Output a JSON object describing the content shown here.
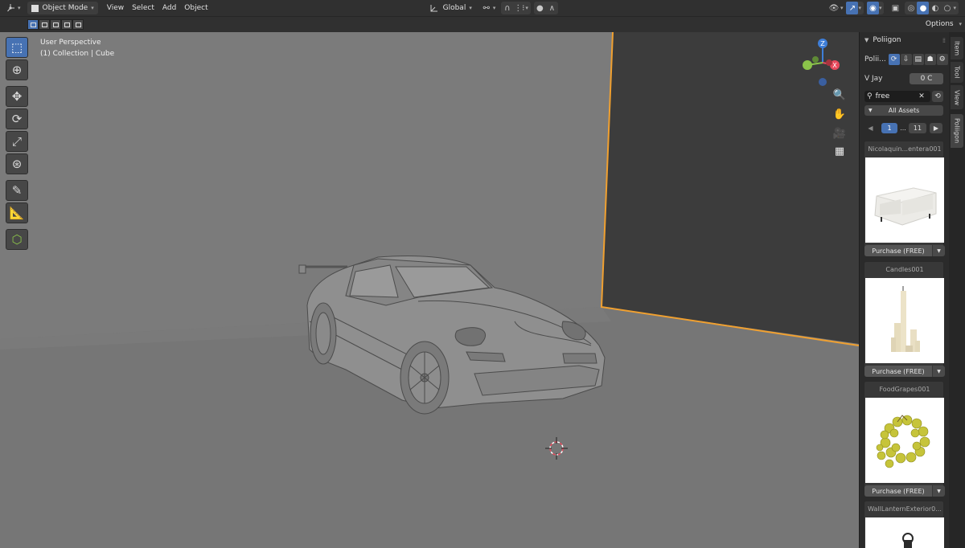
{
  "header": {
    "editor_icon": "3d-viewport-icon",
    "mode": "Object Mode",
    "menus": [
      "View",
      "Select",
      "Add",
      "Object"
    ],
    "transform_orientation": "Global",
    "options_label": "Options"
  },
  "viewport": {
    "perspective": "User Perspective",
    "collection": "(1) Collection | Cube",
    "gizmo_axes": [
      "Z",
      "X",
      "Y"
    ],
    "colors": {
      "x_axis": "#e84a5c",
      "y_axis": "#8bc34a",
      "z_axis": "#3e7ed8",
      "selection_outline": "#f0a030",
      "panel_accent": "#4772b3"
    }
  },
  "toolbar": {
    "tools": [
      "select-box-icon",
      "cursor-icon",
      "move-icon",
      "rotate-icon",
      "scale-icon",
      "transform-icon",
      "annotate-icon",
      "measure-icon",
      "add-cube-icon"
    ]
  },
  "panel": {
    "title": "Poliigon",
    "account_label": "Polii...",
    "user_name": "V Jay",
    "credits": "0 C",
    "search_value": "free",
    "filter": "All Assets",
    "pagination": {
      "current": "1",
      "ellipsis": "...",
      "last": "11"
    },
    "assets": [
      {
        "name": "Nicolaquin...entera001",
        "action": "Purchase (FREE)"
      },
      {
        "name": "Candles001",
        "action": "Purchase (FREE)"
      },
      {
        "name": "FoodGrapes001",
        "action": "Purchase (FREE)"
      },
      {
        "name": "WallLanternExterior0...",
        "action": ""
      }
    ]
  },
  "tabs": [
    "Item",
    "Tool",
    "View",
    "Poliigon"
  ]
}
